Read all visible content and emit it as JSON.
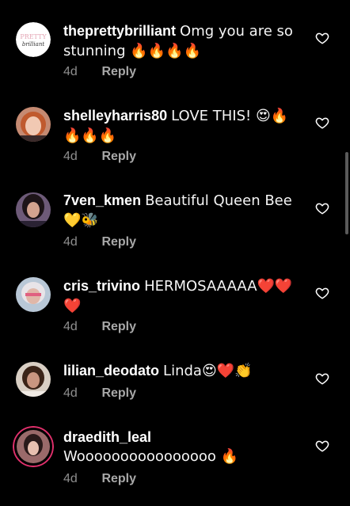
{
  "colors": {
    "background": "#000000",
    "text": "#f5f5f5",
    "meta": "#8e8e8e",
    "story_ring": "#e1306c"
  },
  "comments": [
    {
      "username": "theprettybrilliant",
      "text": "Omg you are so stunning 🔥🔥🔥🔥",
      "age": "4d",
      "reply": "Reply",
      "avatar_icon": "pretty-brilliant-logo",
      "avatar_logo_text": "PRETTY brilliant",
      "like_icon": "heart-outline-icon"
    },
    {
      "username": "shelleyharris80",
      "text": "LOVE THIS! 😍🔥🔥🔥🔥",
      "age": "4d",
      "reply": "Reply",
      "avatar_icon": "profile-photo",
      "like_icon": "heart-outline-icon"
    },
    {
      "username": "7ven_kmen",
      "text": "Beautiful Queen Bee 💛🐝",
      "age": "4d",
      "reply": "Reply",
      "avatar_icon": "profile-photo",
      "like_icon": "heart-outline-icon"
    },
    {
      "username": "cris_trivino",
      "text": "HERMOSAAAAA❤️❤️❤️",
      "age": "4d",
      "reply": "Reply",
      "avatar_icon": "profile-photo",
      "like_icon": "heart-outline-icon"
    },
    {
      "username": "lilian_deodato",
      "text": "Linda😍❤️👏",
      "age": "4d",
      "reply": "Reply",
      "avatar_icon": "profile-photo",
      "like_icon": "heart-outline-icon"
    },
    {
      "username": "draedith_leal",
      "text": "Woooooooooooooooo 🔥",
      "age": "4d",
      "reply": "Reply",
      "avatar_icon": "profile-photo-story-ring",
      "like_icon": "heart-outline-icon"
    }
  ]
}
